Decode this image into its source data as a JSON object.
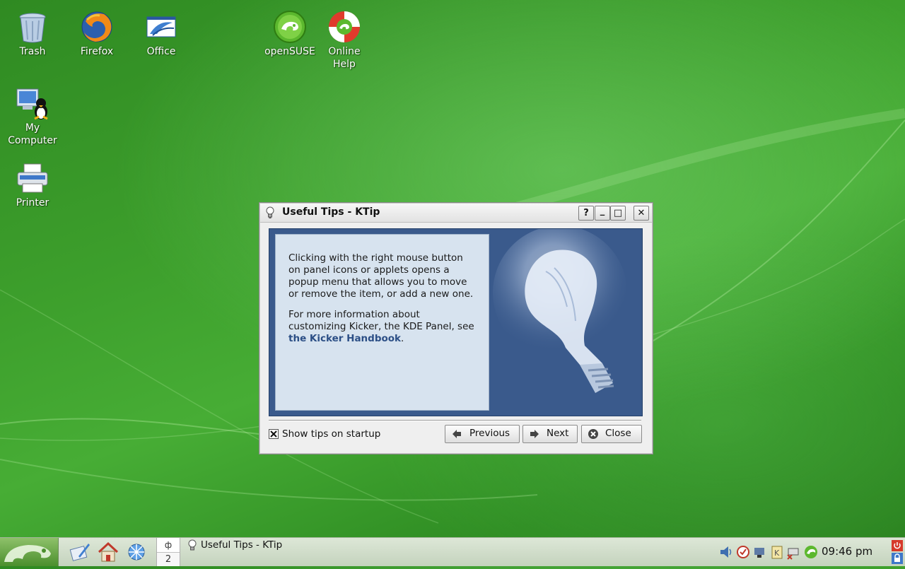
{
  "desktop": {
    "icons": [
      {
        "label": "Trash"
      },
      {
        "label": "Firefox"
      },
      {
        "label": "Office"
      },
      {
        "label": "openSUSE"
      },
      {
        "label": "Online Help"
      },
      {
        "label": "My Computer"
      },
      {
        "label": "Printer"
      }
    ]
  },
  "dialog": {
    "title": "Useful Tips - KTip",
    "title_buttons": {
      "help": "?",
      "minimize": "_",
      "maximize": "□",
      "close": "✕"
    },
    "tip_paragraph_1": "Clicking with the right mouse button on panel icons or applets opens a popup menu that allows you to move or remove the item, or add a new one.",
    "tip_paragraph_2_prefix": "For more information about customizing Kicker, the KDE Panel, see ",
    "tip_link": "the Kicker Handbook",
    "tip_paragraph_2_suffix": ".",
    "show_tips_label": "Show tips on startup",
    "show_tips_checked": true,
    "buttons": {
      "previous": "Previous",
      "next": "Next",
      "close": "Close"
    },
    "colors": {
      "frame": "#3a5a8c",
      "panel": "#d7e3ef",
      "link": "#2c4f86"
    }
  },
  "taskbar": {
    "pager": {
      "desk_indicator": "ф",
      "current_desktop": "2"
    },
    "task_label": "Useful Tips - KTip",
    "clock": "09:46 pm",
    "launchers": [
      "write-icon",
      "home-icon",
      "network-icon"
    ],
    "tray": [
      "volume-icon",
      "updater-icon",
      "network-status-icon",
      "klipper-icon",
      "printer-status-icon",
      "suse-icon"
    ]
  }
}
